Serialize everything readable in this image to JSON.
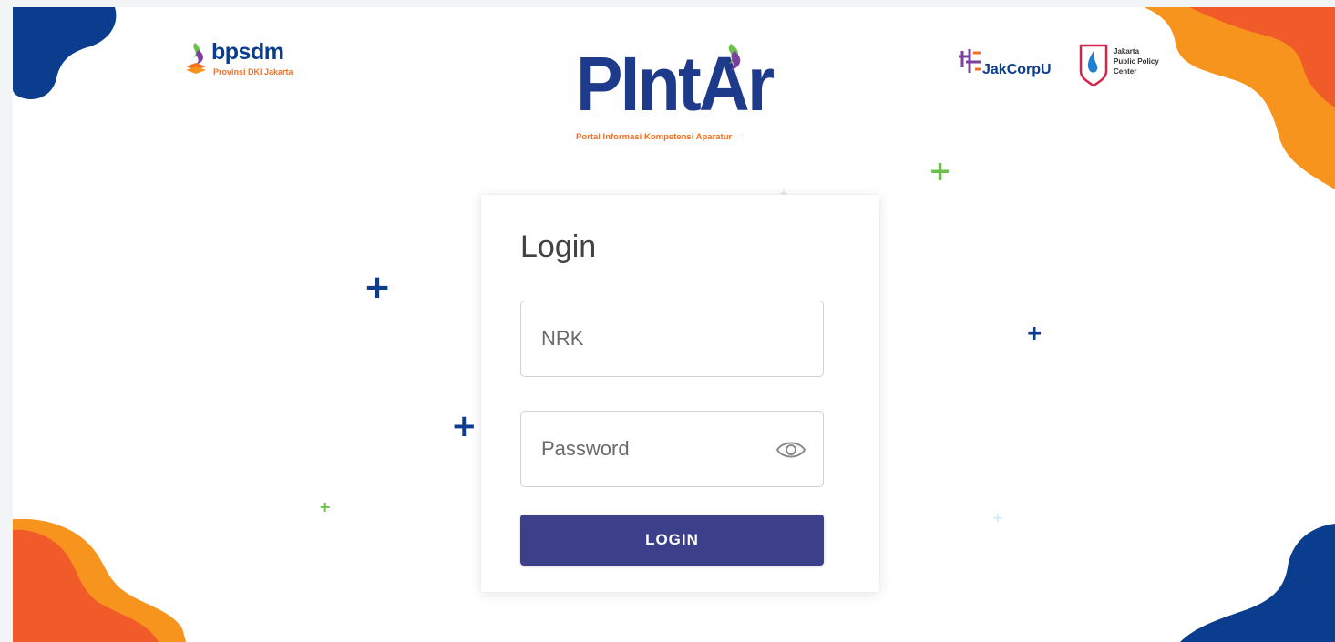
{
  "logos": {
    "bpsdm": {
      "name": "bpsdm",
      "sub": "Provinsi DKI Jakarta"
    },
    "pintar": {
      "name": "PIntAr",
      "tagline": "Portal Informasi Kompetensi Aparatur"
    },
    "jakcorpu": {
      "name": "JakCorpU"
    },
    "jppc": {
      "lines": [
        "Jakarta",
        "Public Policy",
        "Center"
      ]
    }
  },
  "login": {
    "title": "Login",
    "nrk_placeholder": "NRK",
    "password_placeholder": "Password",
    "button_label": "LOGIN"
  },
  "icons": {
    "password_toggle": "eye-icon",
    "decorations": "plus-icon"
  },
  "colors": {
    "navy": "#0b3d8f",
    "orange": "#f37021",
    "light_orange": "#f7941d",
    "green": "#6abf4b",
    "button": "#3c3f8a",
    "purple": "#7b3fa0"
  }
}
